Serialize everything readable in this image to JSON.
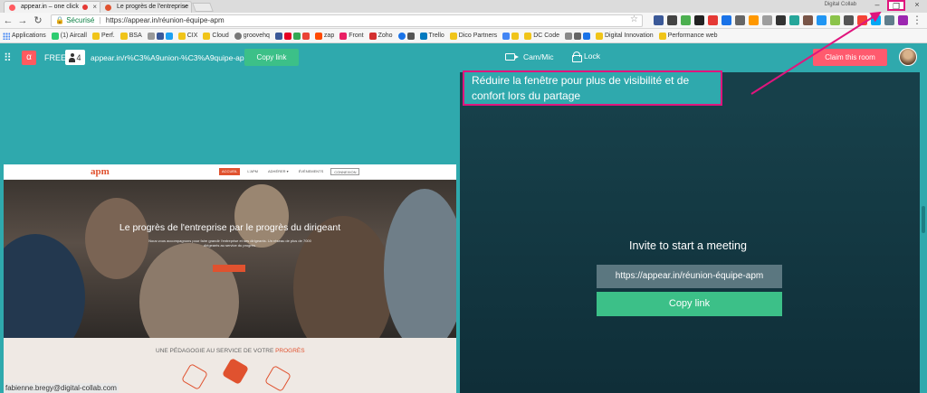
{
  "browser": {
    "tabs": [
      {
        "title": "appear.in – one click",
        "favicon_color": "#ff5a5f",
        "recording": true
      },
      {
        "title": "Le progrès de l'entreprise",
        "favicon_color": "#e0522f",
        "recording": false
      }
    ],
    "user_name": "Digital Collab",
    "omnibox": {
      "secure_label": "Sécurisé",
      "url": "https://appear.in/réunion-équipe-apm"
    },
    "bookmarks": [
      "Applications",
      "(1) Aircall",
      "Perf.",
      "BSA",
      "CIX",
      "Cloud",
      "groovehq",
      "zap",
      "Front",
      "Zoho",
      "Trello",
      "Dico Partners",
      "DC Code",
      "Digital Innovation",
      "Performance web"
    ],
    "colors": {
      "highlight": "#e0157d"
    }
  },
  "app": {
    "logo_glyph": "α",
    "plan": "FREE",
    "participant_count": "4",
    "room_url": "appear.in/r%C3%A9union-%C3%A9quipe-apm",
    "copy_link_top": "Copy link",
    "cam_mic": "Cam/Mic",
    "lock": "Lock",
    "claim_room": "Claim this room",
    "accent_teal": "#2fa9ad",
    "accent_green": "#3cc088",
    "accent_red": "#ff5a6e"
  },
  "annotation": {
    "line1": "Réduire la fenêtre pour plus de visibilité et de",
    "line2": "confort lors du partage"
  },
  "shared_screen": {
    "site_logo": "apm",
    "nav": [
      "ACCUEIL",
      "L'APM",
      "ADHÉRER ▾",
      "ÉVÉNEMENTS",
      "CONNEXION"
    ],
    "hero_title": "Le progrès de l'entreprise par le progrès du dirigeant",
    "hero_sub": "Nous vous accompagnons pour faire grandir l'entreprise et ses dirigeants. Un réseau de plus de 7000 dirigeants au service du progrès.",
    "section_title_prefix": "UNE PÉDAGOGIE AU SERVICE DE VOTRE",
    "section_title_highlight": "PROGRÈS",
    "presenter_email": "fabienne.bregy@digital-collab.com"
  },
  "invite": {
    "title": "Invite to start a meeting",
    "url": "https://appear.in/réunion-équipe-apm",
    "copy_link": "Copy link"
  }
}
